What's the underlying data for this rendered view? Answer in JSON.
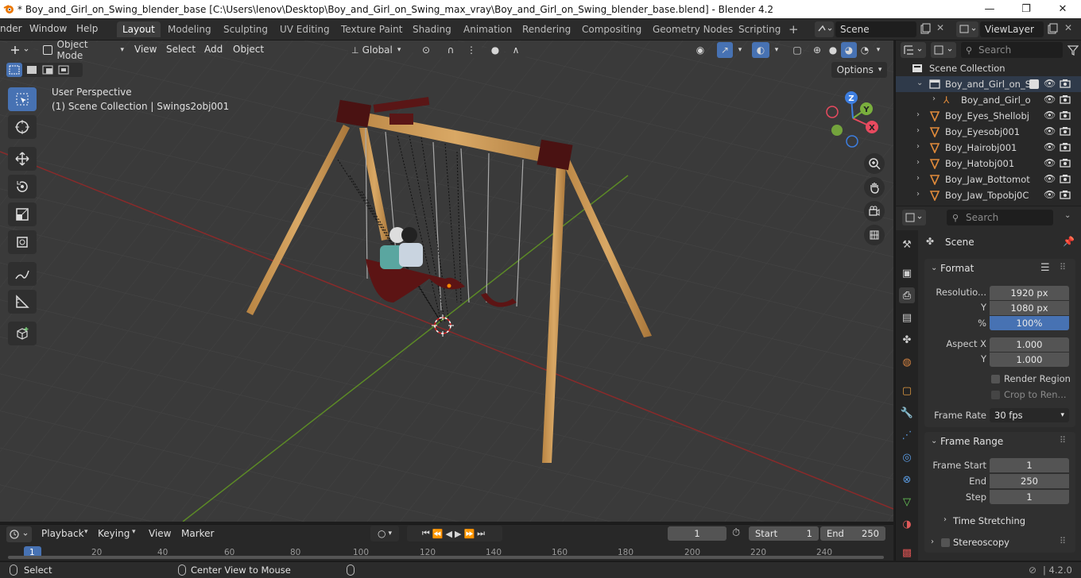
{
  "window": {
    "title": "* Boy_and_Girl_on_Swing_blender_base [C:\\Users\\lenov\\Desktop\\Boy_and_Girl_on_Swing_max_vray\\Boy_and_Girl_on_Swing_blender_base.blend] - Blender 4.2",
    "minimize": "—",
    "maximize": "❐",
    "close": "✕"
  },
  "menubar": {
    "items": [
      "nder",
      "Window",
      "Help"
    ],
    "workspaces": [
      "Layout",
      "Modeling",
      "Sculpting",
      "UV Editing",
      "Texture Paint",
      "Shading",
      "Animation",
      "Rendering",
      "Compositing",
      "Geometry Nodes",
      "Scripting"
    ],
    "add_workspace": "+",
    "scene": "Scene",
    "view_layer": "ViewLayer"
  },
  "viewport_header": {
    "mode": "Object Mode",
    "menus": [
      "View",
      "Select",
      "Add",
      "Object"
    ],
    "transform_orientation": "Global",
    "options": "Options"
  },
  "viewport": {
    "perspective_label": "User Perspective",
    "collection_label": "(1) Scene Collection | Swings2obj001",
    "axes": {
      "x": "X",
      "y": "Y",
      "z": "Z"
    },
    "accent": "#4772b3"
  },
  "outliner": {
    "search_placeholder": "Search",
    "root": "Scene Collection",
    "rows": [
      {
        "name": "Boy_and_Girl_on_S",
        "icon": "collection-icon"
      },
      {
        "name": "Boy_and_Girl_o",
        "icon": "armature-icon"
      },
      {
        "name": "Boy_Eyes_Shellobj",
        "icon": "mesh-icon"
      },
      {
        "name": "Boy_Eyesobj001",
        "icon": "mesh-icon"
      },
      {
        "name": "Boy_Hairobj001",
        "icon": "mesh-icon"
      },
      {
        "name": "Boy_Hatobj001",
        "icon": "mesh-icon"
      },
      {
        "name": "Boy_Jaw_Bottomot",
        "icon": "mesh-icon"
      },
      {
        "name": "Boy_Jaw_Topobj0C",
        "icon": "mesh-icon"
      }
    ]
  },
  "properties": {
    "search_placeholder": "Search",
    "context": "Scene",
    "format": {
      "title": "Format",
      "resolution_label": "Resolutio...",
      "resolution_x": "1920 px",
      "y_label": "Y",
      "resolution_y": "1080 px",
      "percent_label": "%",
      "percent": "100%",
      "percent_fraction": 1.0,
      "aspect_label": "Aspect X",
      "aspect_x": "1.000",
      "aspect_y_label": "Y",
      "aspect_y": "1.000",
      "render_region": "Render Region",
      "crop": "Crop to Ren...",
      "frame_rate_label": "Frame Rate",
      "frame_rate": "30 fps"
    },
    "frame_range": {
      "title": "Frame Range",
      "start_label": "Frame Start",
      "start": "1",
      "end_label": "End",
      "end": "250",
      "step_label": "Step",
      "step": "1",
      "time_stretching": "Time Stretching"
    },
    "stereoscopy": "Stereoscopy"
  },
  "timeline": {
    "menus": [
      "Playback",
      "Keying",
      "View",
      "Marker"
    ],
    "current_frame": "1",
    "start_label": "Start",
    "start": "1",
    "end_label": "End",
    "end": "250",
    "ticks": [
      "1",
      "20",
      "40",
      "60",
      "80",
      "100",
      "120",
      "140",
      "160",
      "180",
      "200",
      "220",
      "240"
    ]
  },
  "statusbar": {
    "select": "Select",
    "center_view": "Center View to Mouse",
    "version": "4.2.0"
  }
}
